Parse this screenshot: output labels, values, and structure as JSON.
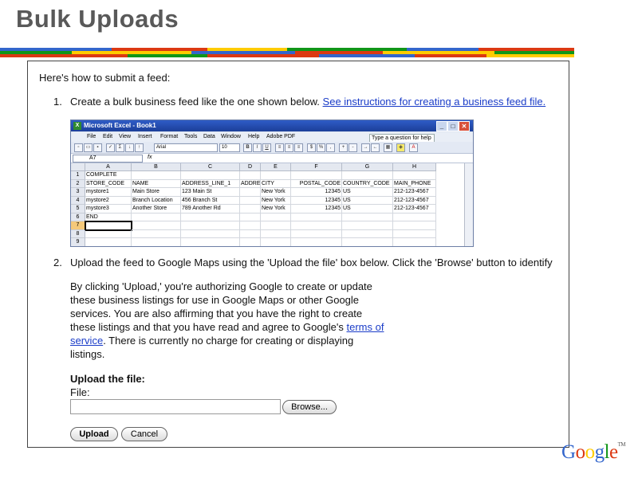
{
  "slide": {
    "title": "Bulk Uploads"
  },
  "stripe_colors": [
    "#3366cc",
    "#dc3912",
    "#ff9900",
    "#109618"
  ],
  "content": {
    "intro": "Here's how to submit a feed:",
    "step1": {
      "number": "1.",
      "text": "Create a bulk business feed like the one shown below.",
      "link": "See instructions for creating a business feed file."
    },
    "step2": {
      "number": "2.",
      "text": "Upload the feed to Google Maps using the 'Upload the file' box below. Click the 'Browse' button to identify"
    },
    "authorization": {
      "before_link": "By clicking 'Upload,' you're authorizing Google to create or update these business listings for use in Google Maps or other Google services. You are also affirming that you have the right to create these listings and that you have read and agree to Google's",
      "link": "terms of service",
      "after_link": ". There is currently no charge for creating or displaying listings."
    },
    "upload": {
      "heading": "Upload the file:",
      "file_label": "File:",
      "file_value": "",
      "browse_label": "Browse...",
      "upload_label": "Upload",
      "cancel_label": "Cancel"
    }
  },
  "excel": {
    "title": "Microsoft Excel - Book1",
    "menu": [
      "File",
      "Edit",
      "View",
      "Insert",
      "Format",
      "Tools",
      "Data",
      "Window",
      "Help",
      "Adobe PDF"
    ],
    "help_placeholder": "Type a question for help",
    "font": "Arial",
    "font_size": "10",
    "name_box": "A7",
    "fx": "fx",
    "columns": [
      "A",
      "B",
      "C",
      "D",
      "E",
      "F",
      "G",
      "H"
    ],
    "rows": [
      {
        "n": "1",
        "cells": [
          "COMPLETE",
          "",
          "",
          "",
          "",
          "",
          "",
          ""
        ]
      },
      {
        "n": "2",
        "cells": [
          "STORE_CODE",
          "NAME",
          "ADDRESS_LINE_1",
          "ADDRE",
          "CITY",
          "POSTAL_CODE",
          "COUNTRY_CODE",
          "MAIN_PHONE"
        ]
      },
      {
        "n": "3",
        "cells": [
          "mystore1",
          "Main Store",
          "123 Main St",
          "",
          "New York",
          "12345",
          "US",
          "212-123-4567"
        ]
      },
      {
        "n": "4",
        "cells": [
          "mystore2",
          "Branch Location",
          "456 Branch St",
          "",
          "New York",
          "12345",
          "US",
          "212-123-4567"
        ]
      },
      {
        "n": "5",
        "cells": [
          "mystore3",
          "Another Store",
          "789 Another Rd",
          "",
          "New York",
          "12345",
          "US",
          "212-123-4567"
        ]
      },
      {
        "n": "6",
        "cells": [
          "END",
          "",
          "",
          "",
          "",
          "",
          "",
          ""
        ]
      },
      {
        "n": "7",
        "cells": [
          "",
          "",
          "",
          "",
          "",
          "",
          "",
          ""
        ]
      },
      {
        "n": "8",
        "cells": [
          "",
          "",
          "",
          "",
          "",
          "",
          "",
          ""
        ]
      },
      {
        "n": "9",
        "cells": [
          "",
          "",
          "",
          "",
          "",
          "",
          "",
          ""
        ]
      }
    ]
  },
  "logo": {
    "text": "Google",
    "tm": "TM"
  }
}
